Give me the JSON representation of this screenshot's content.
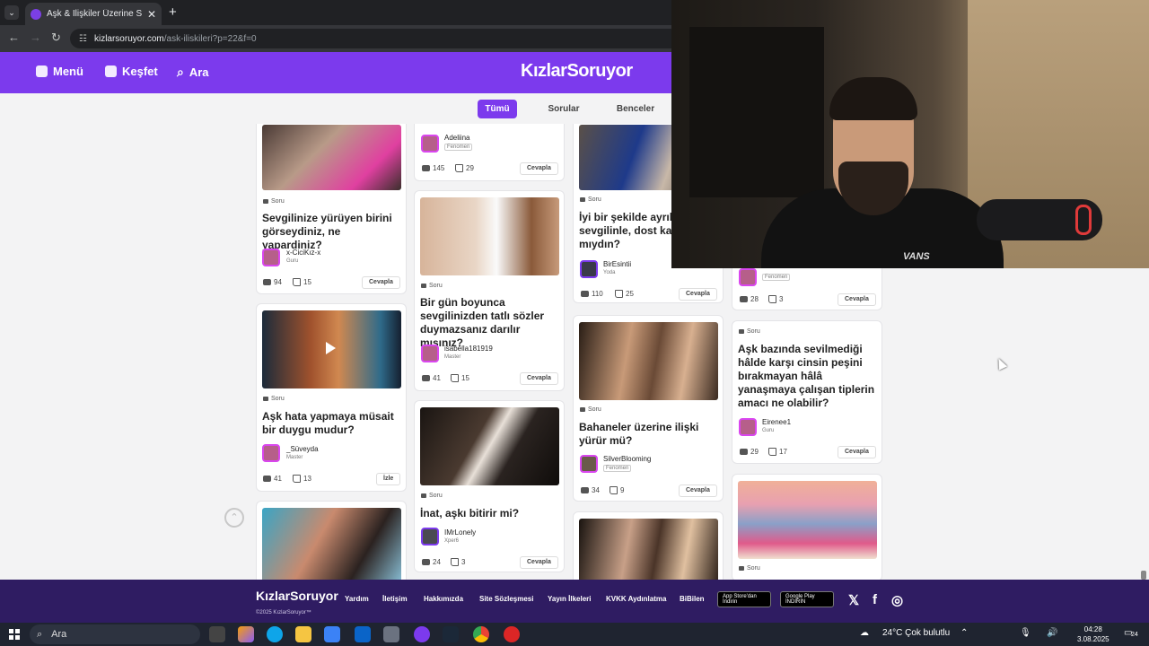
{
  "browser": {
    "tab_title": "Aşk & İlişkiler Üzerine Sorular -",
    "tab_close": "✕",
    "new_tab": "+",
    "url_host": "kizlarsoruyor.com",
    "url_path": "/ask-iliskileri?p=22&f=0"
  },
  "header": {
    "menu_label": "Menü",
    "explore_label": "Keşfet",
    "search_label": "Ara",
    "logo_text": "KızlarSoruyor"
  },
  "filters": {
    "all": "Tümü",
    "questions": "Sorular",
    "opinions": "Benceler"
  },
  "cards": [
    {
      "type": "Soru",
      "title": "Sevgilinize yürüyen birini görseydiniz, ne yapardiniz?",
      "user": "x-CiciKız-x",
      "rank": "Guru",
      "comments": "94",
      "likes": "15",
      "action": "Cevapla"
    },
    {
      "type": "Soru",
      "title": "Aşk hata yapmaya müsait bir duygu mudur?",
      "user": "_Süveyda",
      "rank": "Master",
      "comments": "41",
      "likes": "13",
      "action": "İzle"
    },
    {
      "type": "",
      "title": "",
      "user": "Adeliina",
      "rank": "Fenomen",
      "comments": "145",
      "likes": "29",
      "action": "Cevapla"
    },
    {
      "type": "Soru",
      "title": "Bir gün boyunca sevgilinizden tatlı sözler duymazsanız darılır mısınız?",
      "user": "isabella181919",
      "rank": "Master",
      "comments": "41",
      "likes": "15",
      "action": "Cevapla"
    },
    {
      "type": "Soru",
      "title": "İnat, aşkı bitirir mi?",
      "user": "IMrLonely",
      "rank": "Xper6",
      "comments": "24",
      "likes": "3",
      "action": "Cevapla"
    },
    {
      "type": "Soru",
      "title": "İyi bir şekilde ayrıldığınız sevgilinle, dost kalır mıydın?",
      "user": "BirEsintii",
      "rank": "Yoda",
      "comments": "110",
      "likes": "25",
      "action": "Cevapla"
    },
    {
      "type": "Soru",
      "title": "Bahaneler üzerine ilişki yürür mü?",
      "user": "SilverBlooming",
      "rank": "Fenomen",
      "comments": "34",
      "likes": "9",
      "action": "Cevapla"
    },
    {
      "type": "",
      "title": "",
      "user": "",
      "rank": "Fenomen",
      "comments": "28",
      "likes": "3",
      "action": "Cevapla"
    },
    {
      "type": "Soru",
      "title": "Aşk bazında sevilmediği hâlde karşı cinsin peşini bırakmayan hâlâ yanaşmaya çalışan tiplerin amacı ne olabilir?",
      "user": "Eirenee1",
      "rank": "Guru",
      "comments": "29",
      "likes": "17",
      "action": "Cevapla"
    },
    {
      "type": "Soru"
    }
  ],
  "footer": {
    "logo_text": "KızlarSoruyor",
    "copyright": "©2025 KızlarSoruyor™",
    "links": [
      "Yardım",
      "İletişim",
      "Hakkımızda",
      "Site Sözleşmesi",
      "Yayın İlkeleri",
      "KVKK Aydınlatma",
      "BiBilen"
    ],
    "appstore": "App Store'dan İndirin",
    "googleplay": "Google Play İNDİRİN",
    "x": "𝕏",
    "facebook": "f",
    "instagram": "◎"
  },
  "webcam": {
    "shirt_brand": "VANS"
  },
  "taskbar": {
    "search_placeholder": "Ara",
    "weather": "24°C  Çok bulutlu",
    "time": "04:28",
    "date": "3.08.2025",
    "notifications": "24"
  },
  "colors": {
    "brand": "#7c3aed",
    "footer": "#2f1c62",
    "avatar_border": "#d946ef"
  }
}
